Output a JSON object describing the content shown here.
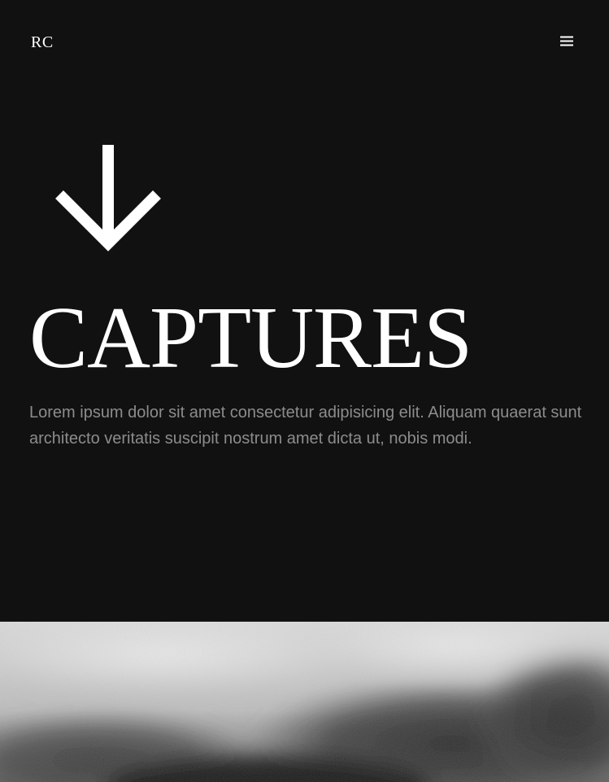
{
  "header": {
    "logo_text": "RC",
    "menu_icon": "hamburger-menu-icon"
  },
  "hero": {
    "arrow_icon": "arrow-down-icon",
    "title": "CAPTURES",
    "intro": "Lorem ipsum dolor sit amet consectetur adipisicing elit. Aliquam quaerat sunt architecto veritatis suscipit nostrum amet dicta ut, nobis modi."
  },
  "photo": {
    "style": "black-and-white blurred photograph"
  },
  "colors": {
    "background": "#111111",
    "title": "#ffffff",
    "body_text": "#8c8c8c"
  }
}
